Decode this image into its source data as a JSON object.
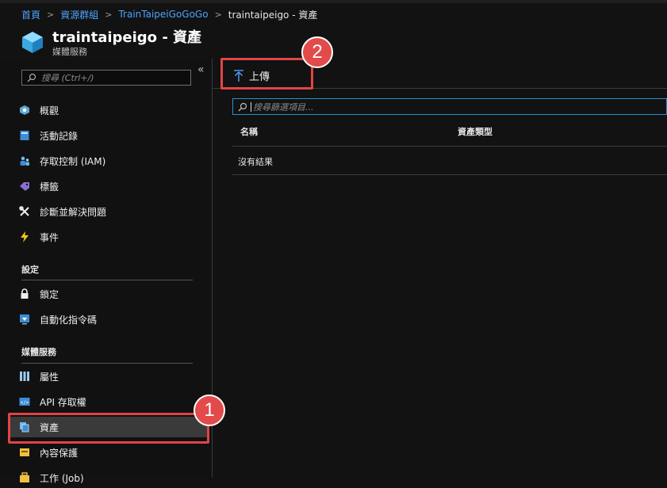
{
  "breadcrumb": {
    "home": "首頁",
    "group": "資源群組",
    "resource": "TrainTaipeiGoGoGo",
    "current": "traintaipeigo - 資產"
  },
  "header": {
    "title": "traintaipeigo - 資產",
    "subtitle": "媒體服務"
  },
  "sidebar": {
    "search_placeholder": "搜尋 (Ctrl+/)",
    "collapse": "«",
    "items_top": [
      {
        "label": "概觀",
        "icon": "overview-icon"
      },
      {
        "label": "活動記錄",
        "icon": "activity-log-icon"
      },
      {
        "label": "存取控制 (IAM)",
        "icon": "iam-icon"
      },
      {
        "label": "標籤",
        "icon": "tag-icon"
      },
      {
        "label": "診斷並解決問題",
        "icon": "wrench-icon"
      },
      {
        "label": "事件",
        "icon": "lightning-icon"
      }
    ],
    "section_settings": "設定",
    "items_settings": [
      {
        "label": "鎖定",
        "icon": "lock-icon"
      },
      {
        "label": "自動化指令碼",
        "icon": "automation-icon"
      }
    ],
    "section_media": "媒體服務",
    "items_media": [
      {
        "label": "屬性",
        "icon": "properties-icon"
      },
      {
        "label": "API 存取權",
        "icon": "api-icon"
      },
      {
        "label": "資產",
        "icon": "assets-icon"
      },
      {
        "label": "內容保護",
        "icon": "content-protection-icon"
      },
      {
        "label": "工作 (Job)",
        "icon": "job-icon"
      }
    ]
  },
  "toolbar": {
    "upload_label": "上傳"
  },
  "filter": {
    "placeholder": "搜尋篩選項目..."
  },
  "table": {
    "columns": [
      "名稱",
      "資產類型"
    ],
    "empty_text": "沒有結果"
  },
  "callouts": {
    "one": "1",
    "two": "2"
  },
  "colors": {
    "accent": "#2b8fd6",
    "callout": "#e34a4a",
    "selected": "#3a3a3a"
  }
}
